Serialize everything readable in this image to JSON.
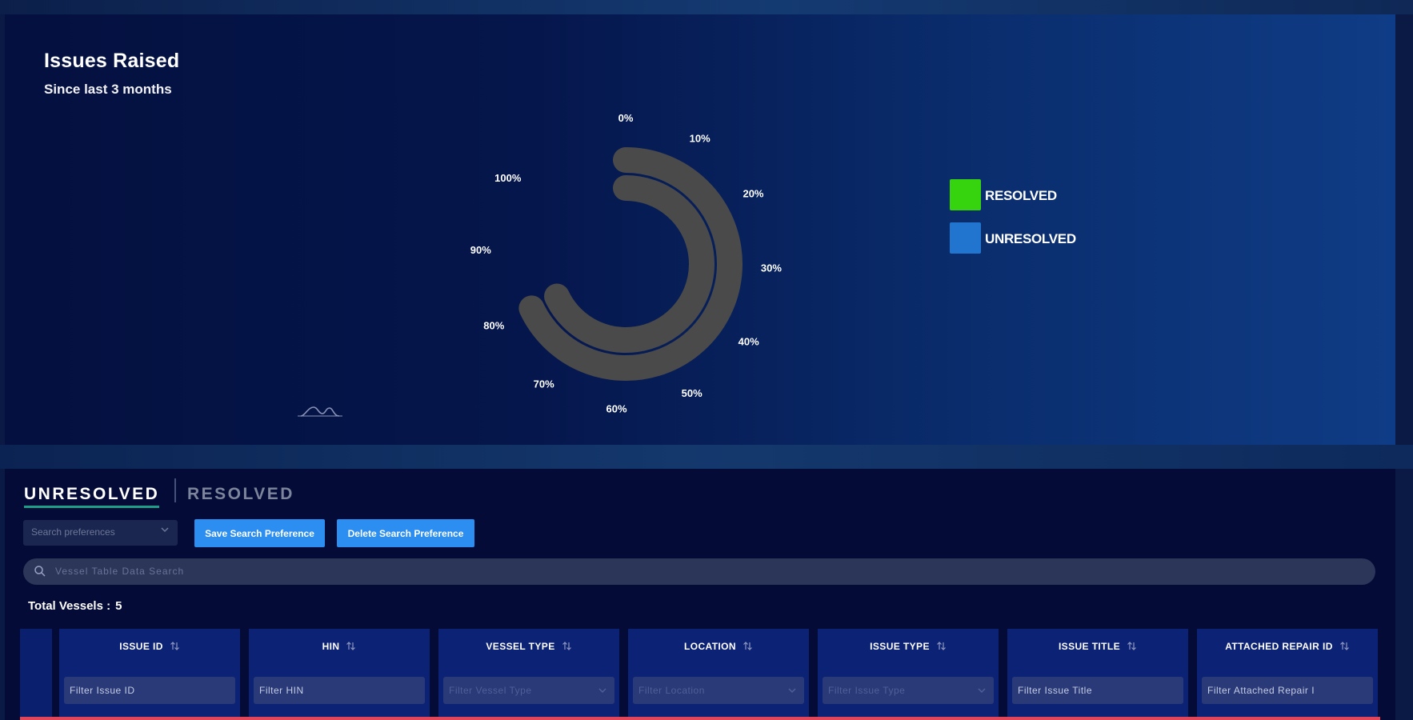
{
  "chart": {
    "title": "Issues Raised",
    "subtitle": "Since last 3 months"
  },
  "colors": {
    "resolved": "#35d40e",
    "unresolved": "#2275cf",
    "ring": "#4a4a4a",
    "tab_underline": "#1e9e86",
    "button": "#2b8ef0"
  },
  "chart_data": {
    "type": "radial-bar",
    "title": "Issues Raised",
    "subtitle": "Since last 3 months",
    "scale_labels": [
      "0%",
      "10%",
      "20%",
      "30%",
      "40%",
      "50%",
      "60%",
      "70%",
      "80%",
      "90%",
      "100%"
    ],
    "series": [
      {
        "name": "RESOLVED",
        "color": "#35d40e",
        "percent": 80
      },
      {
        "name": "UNRESOLVED",
        "color": "#2275cf",
        "percent": 80
      }
    ],
    "legend_position": "right"
  },
  "legend": [
    {
      "label": "RESOLVED",
      "color": "#35d40e"
    },
    {
      "label": "UNRESOLVED",
      "color": "#2275cf"
    }
  ],
  "tabs": {
    "active": "UNRESOLVED",
    "inactive": "RESOLVED"
  },
  "preferences": {
    "placeholder": "Search preferences",
    "save_label": "Save Search Preference",
    "delete_label": "Delete Search Preference"
  },
  "search": {
    "placeholder": "Vessel Table Data Search"
  },
  "totals": {
    "label": "Total Vessels :",
    "value": "5"
  },
  "table": {
    "columns": [
      {
        "header": "ISSUE ID",
        "filter": "Filter Issue ID",
        "dropdown": false
      },
      {
        "header": "HIN",
        "filter": "Filter HIN",
        "dropdown": false
      },
      {
        "header": "VESSEL TYPE",
        "filter": "Filter Vessel Type",
        "dropdown": true
      },
      {
        "header": "LOCATION",
        "filter": "Filter Location",
        "dropdown": true
      },
      {
        "header": "ISSUE TYPE",
        "filter": "Filter Issue Type",
        "dropdown": true
      },
      {
        "header": "ISSUE TITLE",
        "filter": "Filter Issue Title",
        "dropdown": false
      },
      {
        "header": "ATTACHED REPAIR ID",
        "filter": "Filter Attached Repair I",
        "dropdown": false
      }
    ]
  }
}
